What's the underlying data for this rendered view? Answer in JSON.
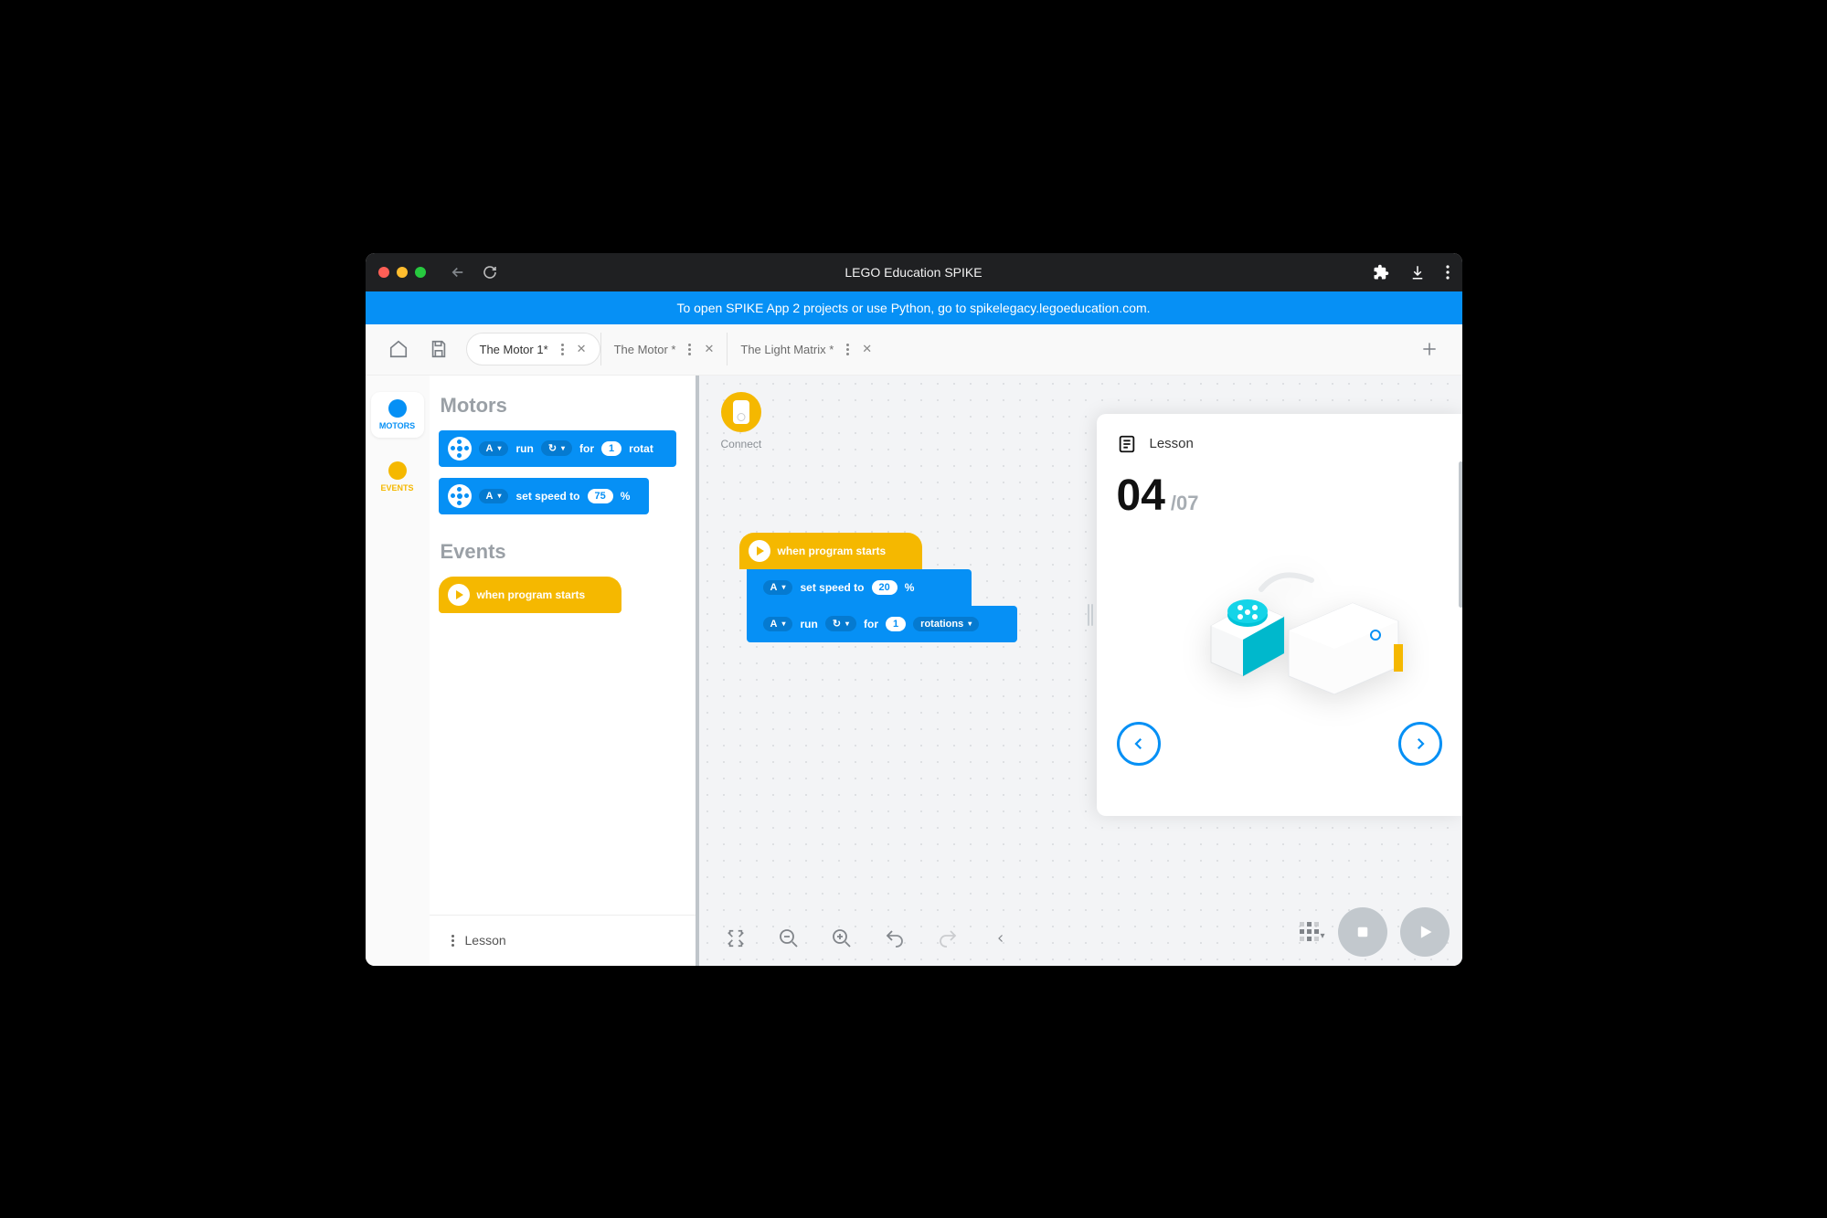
{
  "window": {
    "title": "LEGO Education SPIKE"
  },
  "banner": {
    "text": "To open SPIKE App 2 projects or use Python, go to spikelegacy.legoeducation.com."
  },
  "tabs": [
    {
      "label": "The Motor 1*",
      "active": true
    },
    {
      "label": "The Motor *",
      "active": false
    },
    {
      "label": "The Light Matrix *",
      "active": false
    }
  ],
  "sidebar": [
    {
      "label": "MOTORS",
      "color": "#0690f5",
      "active": true
    },
    {
      "label": "EVENTS",
      "color": "#f5b800",
      "active": false
    }
  ],
  "palette": {
    "motors_heading": "Motors",
    "events_heading": "Events",
    "block_run": {
      "port": "A",
      "text_run": "run",
      "text_for": "for",
      "value": "1",
      "unit": "rotat"
    },
    "block_speed": {
      "port": "A",
      "text": "set speed to",
      "value": "75",
      "unit": "%"
    },
    "block_event": {
      "text": "when program starts"
    }
  },
  "canvas": {
    "connect_label": "Connect",
    "event": {
      "text": "when program starts"
    },
    "speed": {
      "port": "A",
      "text": "set speed to",
      "value": "20",
      "unit": "%"
    },
    "run": {
      "port": "A",
      "text_run": "run",
      "text_for": "for",
      "value": "1",
      "unit": "rotations"
    }
  },
  "lesson": {
    "heading": "Lesson",
    "step": "04",
    "total": "/07"
  },
  "footer": {
    "lesson_label": "Lesson"
  }
}
